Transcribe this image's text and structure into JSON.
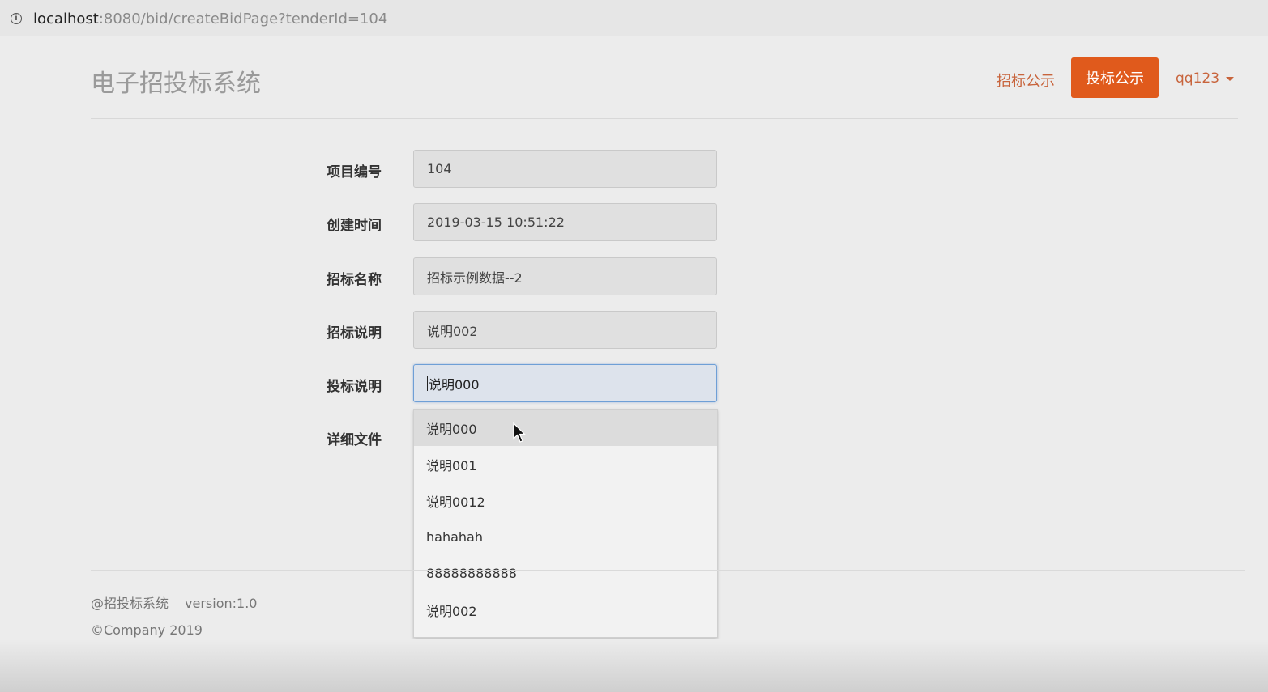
{
  "browser": {
    "url_host": "localhost",
    "url_rest": ":8080/bid/createBidPage?tenderId=104"
  },
  "header": {
    "brand": "电子招投标系统",
    "nav": {
      "tender_notice": "招标公示",
      "bid_notice": "投标公示",
      "user": "qq123"
    }
  },
  "form": {
    "project_no": {
      "label": "项目编号",
      "value": "104"
    },
    "created_time": {
      "label": "创建时间",
      "value": "2019-03-15 10:51:22"
    },
    "tender_name": {
      "label": "招标名称",
      "value": "招标示例数据--2"
    },
    "tender_desc": {
      "label": "招标说明",
      "value": "说明002"
    },
    "bid_desc": {
      "label": "投标说明",
      "value": "说明000"
    },
    "detail_file": {
      "label": "详细文件"
    }
  },
  "autocomplete": {
    "options": [
      "说明000",
      "说明001",
      "说明0012",
      "hahahah",
      "88888888888",
      "说明002"
    ]
  },
  "footer": {
    "line1_name": "@招投标系统",
    "line1_version": "version:1.0",
    "line2": "©Company 2019"
  },
  "colors": {
    "accent": "#e05a1c",
    "link": "#c8643c"
  }
}
